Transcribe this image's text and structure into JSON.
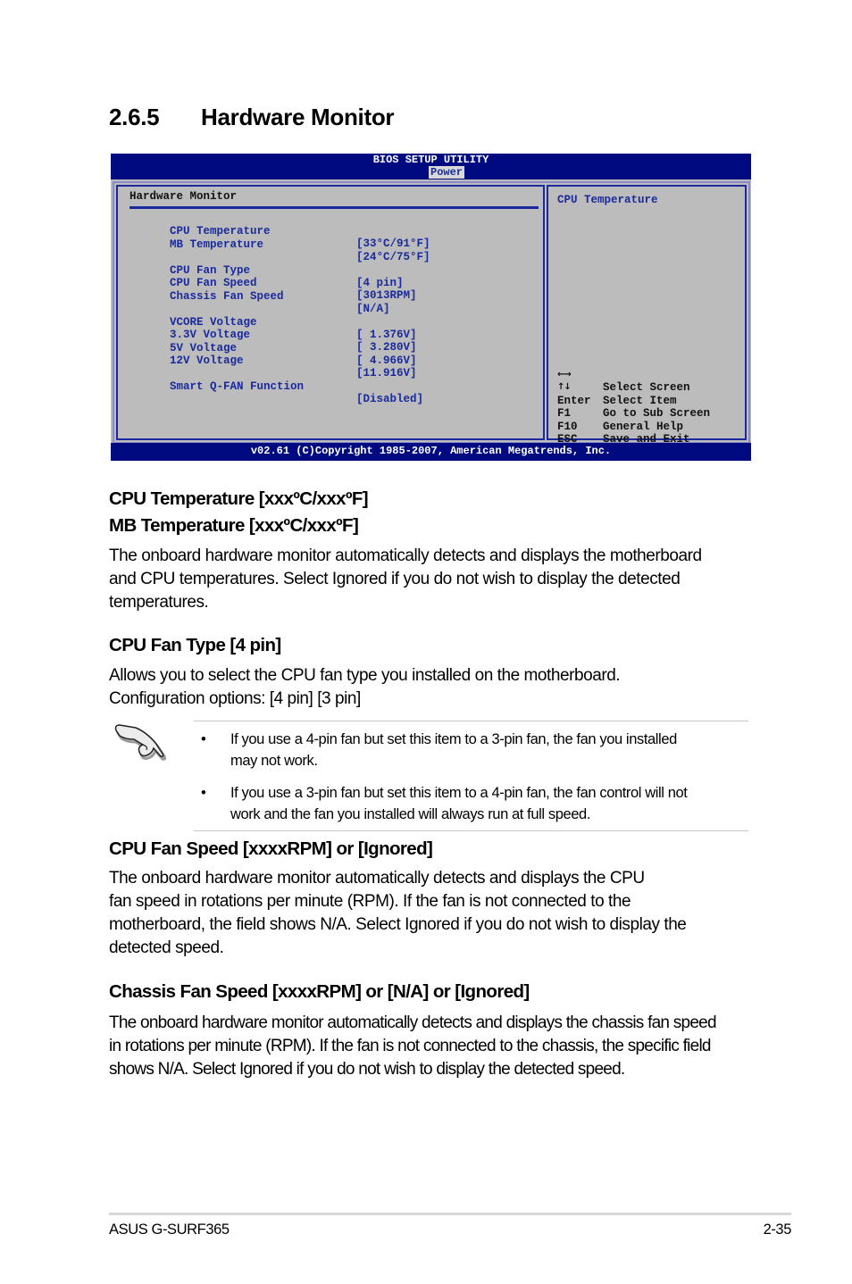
{
  "section": {
    "number": "2.6.5",
    "title": "Hardware Monitor"
  },
  "bios": {
    "header_title": "BIOS SETUP UTILITY",
    "active_tab": "Power",
    "panel_title": "Hardware Monitor",
    "rows": [
      {
        "label": "CPU Temperature",
        "value": "[33°C/91°F]"
      },
      {
        "label": "MB Temperature",
        "value": "[24°C/75°F]"
      },
      {
        "label": "CPU Fan Type",
        "value": "[4 pin]"
      },
      {
        "label": "CPU Fan Speed",
        "value": "[3013RPM]"
      },
      {
        "label": "Chassis Fan Speed",
        "value": "[N/A]"
      },
      {
        "label": "VCORE Voltage",
        "value": "[ 1.376V]"
      },
      {
        "label": "3.3V Voltage",
        "value": "[ 3.280V]"
      },
      {
        "label": "5V Voltage",
        "value": "[ 4.966V]"
      },
      {
        "label": "12V Voltage",
        "value": "[11.916V]"
      },
      {
        "label": "Smart Q-FAN Function",
        "value": "[Disabled]"
      }
    ],
    "help_title": "CPU Temperature",
    "keys": [
      {
        "key": "←→",
        "icon": "left-right-arrows-icon",
        "desc": "Select Screen"
      },
      {
        "key": "↑↓",
        "icon": "up-down-arrows-icon",
        "desc": "Select Item"
      },
      {
        "key": "Enter",
        "desc": "Go to Sub Screen"
      },
      {
        "key": "F1",
        "desc": "General Help"
      },
      {
        "key": "F10",
        "desc": "Save and Exit"
      },
      {
        "key": "ESC",
        "desc": "Exit"
      }
    ],
    "footer": "v02.61 (C)Copyright 1985-2007, American Megatrends, Inc.",
    "colors": {
      "header_bg": "#000a80",
      "panel_bg": "#bcbcbc",
      "text_blue": "#1a2a9c"
    }
  },
  "doc": {
    "temp_heading_1": "CPU Temperature [xxxºC/xxxºF]",
    "temp_heading_2": "MB Temperature [xxxºC/xxxºF]",
    "temp_body_1": "The onboard hardware monitor automatically detects and displays the motherboard",
    "temp_body_2": "and CPU temperatures. Select Ignored if you do not wish to display the detected",
    "temp_body_3": "temperatures.",
    "fan_type_heading": "CPU Fan Type [4 pin]",
    "fan_type_body_1": "Allows you to select the CPU fan type you installed on the motherboard.",
    "fan_type_body_2": "Configuration options: [4 pin] [3 pin]",
    "note": {
      "icon": "pointing-hand-icon",
      "bullet": "•",
      "items": [
        {
          "line1": "If you use a 4-pin fan but set this item to a 3-pin fan, the fan you installed",
          "line2": "may not work."
        },
        {
          "line1": "If you use a 3-pin fan but set this item to a 4-pin fan, the fan control will not",
          "line2": "work and the fan you installed will always run at full speed."
        }
      ]
    },
    "cpu_fan_heading": "CPU Fan Speed [xxxxRPM] or [Ignored]",
    "cpu_fan_body_1": "The onboard hardware monitor automatically detects and displays the CPU",
    "cpu_fan_body_2": "fan speed in rotations per minute (RPM). If the fan is not connected to the",
    "cpu_fan_body_3": "motherboard, the field shows N/A. Select Ignored if you do not wish to display the",
    "cpu_fan_body_4": "detected speed.",
    "chassis_fan_heading": "Chassis Fan Speed [xxxxRPM] or [N/A] or [Ignored]",
    "chassis_fan_body_1": "The onboard hardware monitor automatically detects and displays the chassis fan speed",
    "chassis_fan_body_2": "in rotations per minute (RPM). If the fan is not connected to the chassis, the specific field",
    "chassis_fan_body_3": "shows N/A. Select Ignored if you do not wish to display the detected speed."
  },
  "footer": {
    "product": "ASUS G-SURF365",
    "page": "2-35"
  }
}
